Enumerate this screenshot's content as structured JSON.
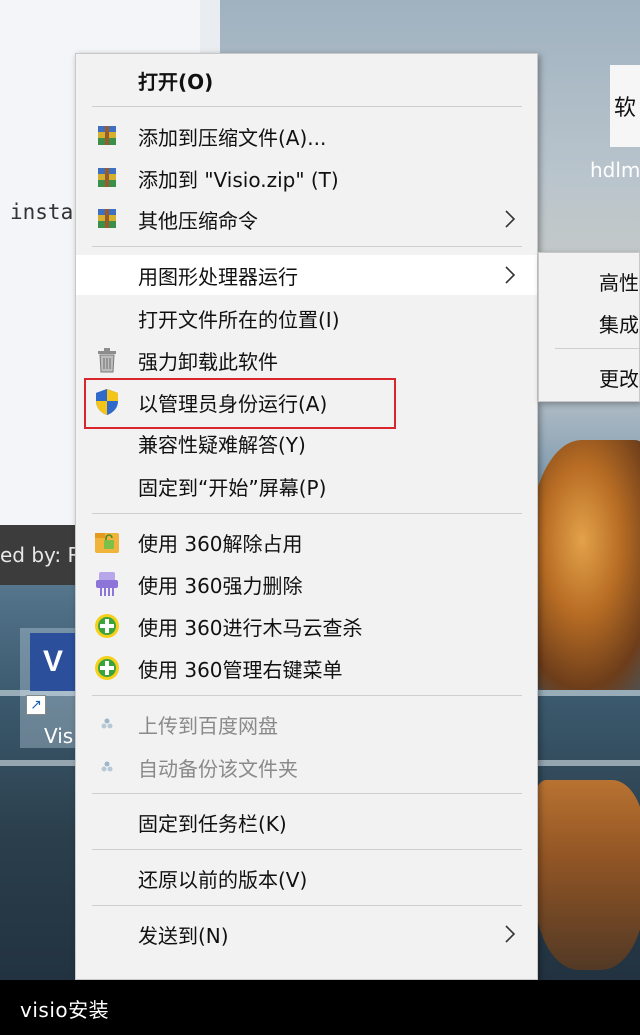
{
  "background": {
    "window_text": "insta",
    "bar_text": "ed by: R",
    "visio_icon_letter": "V",
    "visio_label": "Visio",
    "desktop_icon_label": "hdlm"
  },
  "menu": {
    "items": [
      {
        "label": "打开(O)",
        "icon": null,
        "bold": true
      },
      {
        "label": "添加到压缩文件(A)...",
        "icon": "winrar-icon"
      },
      {
        "label": "添加到 \"Visio.zip\" (T)",
        "icon": "winrar-icon"
      },
      {
        "label": "其他压缩命令",
        "icon": "winrar-icon",
        "submenu": true
      },
      {
        "label": "用图形处理器运行",
        "icon": null,
        "submenu": true,
        "hover": true
      },
      {
        "label": "打开文件所在的位置(I)",
        "icon": null
      },
      {
        "label": "强力卸载此软件",
        "icon": "trash-icon"
      },
      {
        "label": "以管理员身份运行(A)",
        "icon": "uac-shield-icon",
        "highlighted": true
      },
      {
        "label": "兼容性疑难解答(Y)",
        "icon": null
      },
      {
        "label": "固定到“开始”屏幕(P)",
        "icon": null
      },
      {
        "label": "使用 360解除占用",
        "icon": "360-unlock-icon"
      },
      {
        "label": "使用 360强力删除",
        "icon": "360-shredder-icon"
      },
      {
        "label": "使用 360进行木马云查杀",
        "icon": "360-plus-icon"
      },
      {
        "label": "使用 360管理右键菜单",
        "icon": "360-plus-icon"
      },
      {
        "label": "上传到百度网盘",
        "icon": "baidu-cloud-icon",
        "disabled": true
      },
      {
        "label": "自动备份该文件夹",
        "icon": "baidu-cloud-icon",
        "disabled": true
      },
      {
        "label": "固定到任务栏(K)",
        "icon": null
      },
      {
        "label": "还原以前的版本(V)",
        "icon": null
      },
      {
        "label": "发送到(N)",
        "icon": null,
        "submenu": true
      }
    ]
  },
  "submenu": {
    "items": [
      "高性",
      "集成",
      "更改"
    ]
  },
  "caption": "visio安装",
  "colors": {
    "menu_bg": "#f2f2f2",
    "highlight_border": "#d9262c",
    "hover_bg": "#ffffff"
  }
}
